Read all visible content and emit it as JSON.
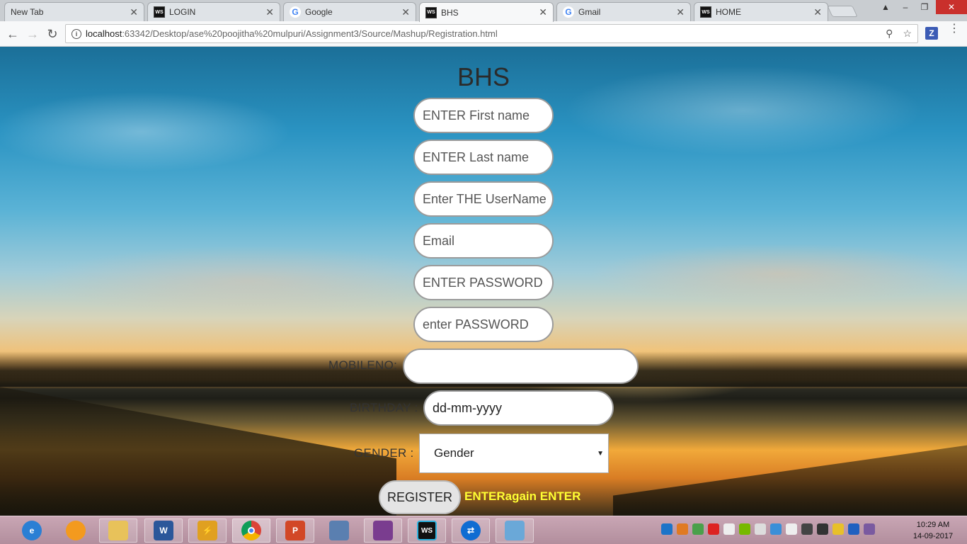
{
  "browser": {
    "tabs": [
      {
        "label": "New Tab",
        "favicon": "none"
      },
      {
        "label": "LOGIN",
        "favicon": "webstorm-icon"
      },
      {
        "label": "Google",
        "favicon": "google-icon"
      },
      {
        "label": "BHS",
        "favicon": "webstorm-icon",
        "active": true
      },
      {
        "label": "Gmail",
        "favicon": "google-icon"
      },
      {
        "label": "HOME",
        "favicon": "webstorm-icon"
      }
    ],
    "url_host": "localhost",
    "url_rest": ":63342/Desktop/ase%20poojitha%20mulpuri/Assignment3/Source/Mashup/Registration.html",
    "extension_label": "Z"
  },
  "page": {
    "title": "BHS",
    "fields": {
      "first_name_placeholder": "ENTER First name",
      "last_name_placeholder": "ENTER Last name",
      "username_placeholder": "Enter THE UserName",
      "email_placeholder": "Email",
      "password_placeholder": "ENTER PASSWORD",
      "confirm_password_placeholder": "enter PASSWORD"
    },
    "mobile_label": "MOBILENO:",
    "mobile_value": "",
    "birthday_label": "BIRTHDAY :",
    "birthday_value": "dd-mm-yyyy",
    "gender_label": "GENDER :",
    "gender_selected": "Gender",
    "register_label": "REGISTER",
    "message": "ENTERagain ENTER",
    "message_color": "#ffff33"
  },
  "taskbar": {
    "clock_time": "10:29 AM",
    "clock_date": "14-09-2017"
  }
}
